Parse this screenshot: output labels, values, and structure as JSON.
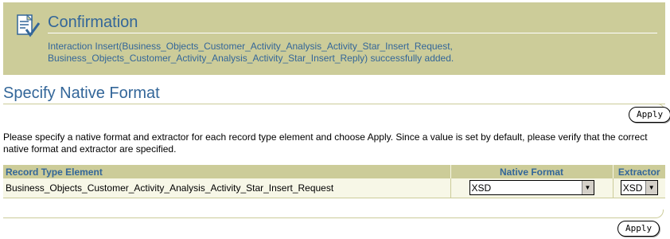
{
  "confirmation": {
    "icon": "confirmation-document-check-icon",
    "title": "Confirmation",
    "message_line1": "Interaction Insert(Business_Objects_Customer_Activity_Analysis_Activity_Star_Insert_Request,",
    "message_line2": "Business_Objects_Customer_Activity_Analysis_Activity_Star_Insert_Reply) successfully added."
  },
  "section": {
    "title": "Specify Native Format",
    "apply_top_label": "Apply",
    "apply_bottom_label": "Apply",
    "instructions": "Please specify a native format and extractor for each record type element and choose Apply. Since a value is set by default, please verify that the correct native format and extractor are specified."
  },
  "table": {
    "columns": [
      "Record Type Element",
      "Native Format",
      "Extractor"
    ],
    "rows": [
      {
        "record_type_element": "Business_Objects_Customer_Activity_Analysis_Activity_Star_Insert_Request",
        "native_format": "XSD",
        "extractor": "XSD"
      }
    ]
  },
  "colors": {
    "header_bg": "#cccc99",
    "accent_text": "#336699",
    "row_bg": "#f7f7e7"
  }
}
